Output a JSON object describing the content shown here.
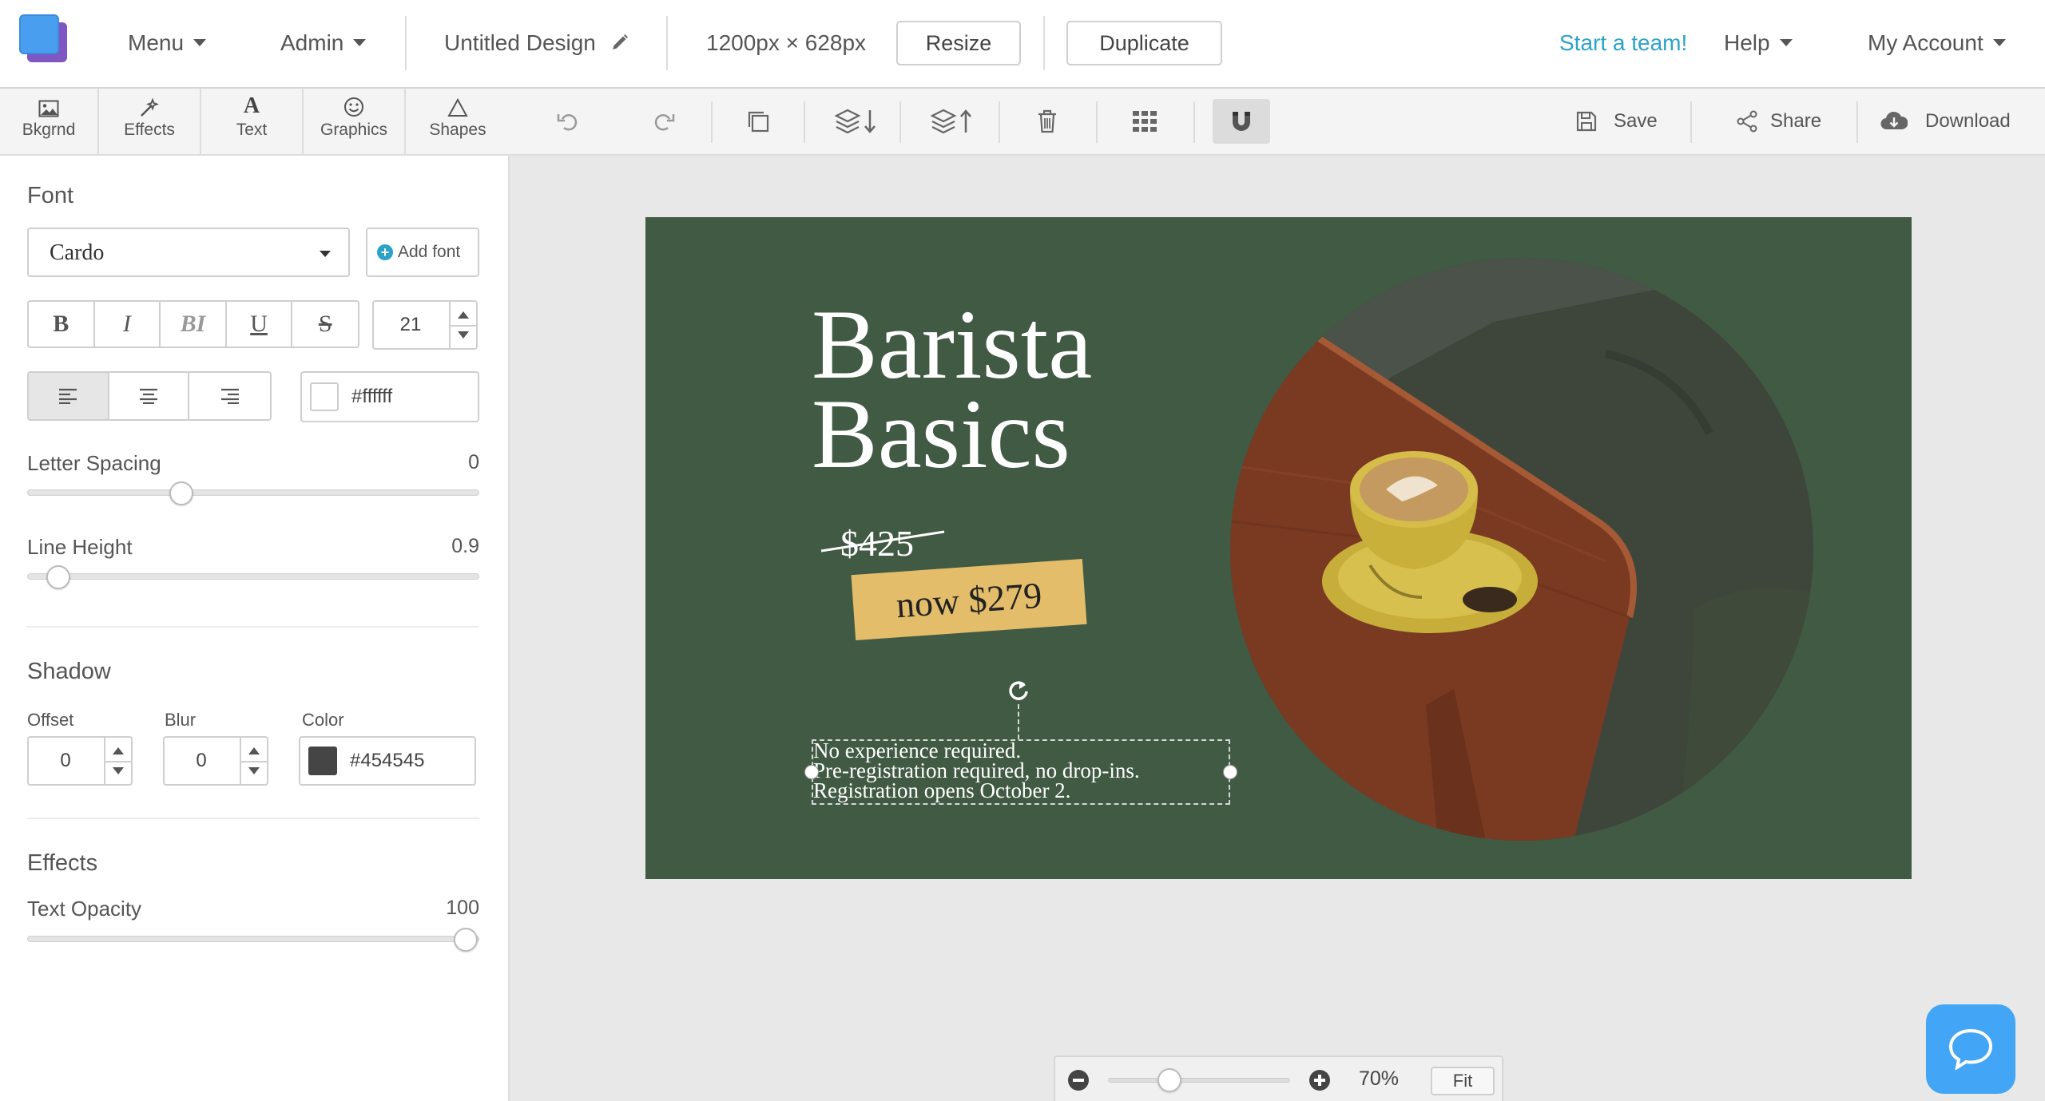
{
  "topbar": {
    "menu_label": "Menu",
    "admin_label": "Admin",
    "design_title": "Untitled Design",
    "dimensions": "1200px × 628px",
    "resize_label": "Resize",
    "duplicate_label": "Duplicate",
    "team_link": "Start a team!",
    "help_label": "Help",
    "account_label": "My Account"
  },
  "left_tabs": [
    {
      "label": "Bkgrnd",
      "icon": "image-icon"
    },
    {
      "label": "Effects",
      "icon": "magic-wand-icon"
    },
    {
      "label": "Text",
      "icon": "text-icon"
    },
    {
      "label": "Graphics",
      "icon": "smiley-icon"
    },
    {
      "label": "Shapes",
      "icon": "triangle-icon"
    }
  ],
  "toolbar": {
    "save_label": "Save",
    "share_label": "Share",
    "download_label": "Download"
  },
  "panel": {
    "font_title": "Font",
    "font_name": "Cardo",
    "add_font_label": "Add font",
    "style_buttons": [
      "B",
      "I",
      "BI",
      "U",
      "S"
    ],
    "font_size": "21",
    "text_color": "#ffffff",
    "letter_spacing_label": "Letter Spacing",
    "letter_spacing_value": "0",
    "line_height_label": "Line Height",
    "line_height_value": "0.9",
    "shadow_title": "Shadow",
    "offset_label": "Offset",
    "offset_value": "0",
    "blur_label": "Blur",
    "blur_value": "0",
    "shadow_color_label": "Color",
    "shadow_color": "#454545",
    "effects_title": "Effects",
    "opacity_label": "Text Opacity",
    "opacity_value": "100"
  },
  "design": {
    "title_line1": "Barista",
    "title_line2": "Basics",
    "old_price": "$425",
    "new_price": "now $279",
    "body_lines": [
      "No experience required.",
      "Pre-registration required, no drop-ins.",
      "Registration opens October 2."
    ],
    "background_color": "#415a43",
    "tag_color": "#e4bd6a"
  },
  "zoom": {
    "percent": "70%",
    "fit_label": "Fit"
  },
  "colors": {
    "accent": "#2ba3c9",
    "chat": "#42a5f5",
    "logo_front": "#4a9ef0",
    "logo_back": "#7e57c2"
  }
}
